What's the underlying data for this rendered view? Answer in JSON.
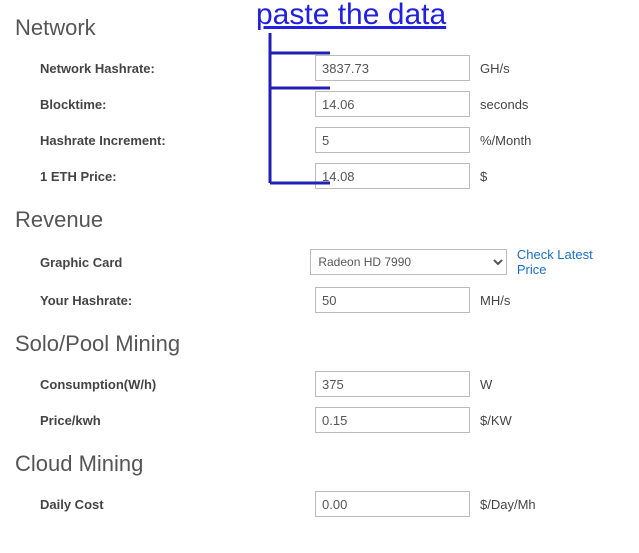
{
  "annotation": {
    "title": "paste the data"
  },
  "sections": {
    "network": {
      "heading": "Network",
      "rows": {
        "hashrate": {
          "label": "Network Hashrate:",
          "value": "3837.73",
          "unit": "GH/s"
        },
        "blocktime": {
          "label": "Blocktime:",
          "value": "14.06",
          "unit": "seconds"
        },
        "increment": {
          "label": "Hashrate Increment:",
          "value": "5",
          "unit": "%/Month"
        },
        "ethprice": {
          "label": "1 ETH Price:",
          "value": "14.08",
          "unit": "$"
        }
      }
    },
    "revenue": {
      "heading": "Revenue",
      "rows": {
        "gpu": {
          "label": "Graphic Card",
          "selected": "Radeon HD 7990",
          "link": "Check Latest Price"
        },
        "yourhashrate": {
          "label": "Your Hashrate:",
          "value": "50",
          "unit": "MH/s"
        }
      }
    },
    "solopool": {
      "heading": "Solo/Pool Mining",
      "rows": {
        "consumption": {
          "label": "Consumption(W/h)",
          "value": "375",
          "unit": "W"
        },
        "pricekwh": {
          "label": "Price/kwh",
          "value": "0.15",
          "unit": "$/KW"
        }
      }
    },
    "cloud": {
      "heading": "Cloud Mining",
      "rows": {
        "dailycost": {
          "label": "Daily Cost",
          "value": "0.00",
          "unit": "$/Day/Mh"
        }
      }
    }
  }
}
